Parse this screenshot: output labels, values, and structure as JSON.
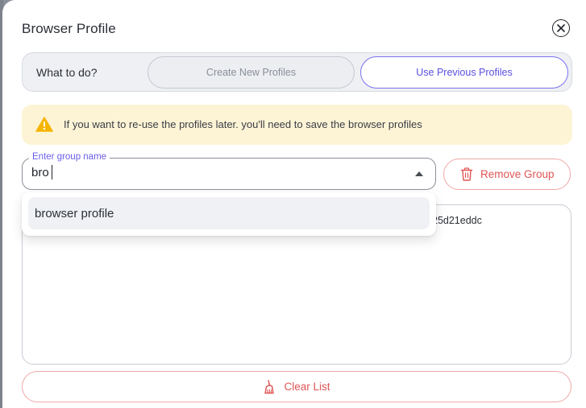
{
  "modal": {
    "title": "Browser Profile"
  },
  "segmented": {
    "label": "What to do?",
    "options": [
      {
        "label": "Create New Profiles",
        "active": false
      },
      {
        "label": "Use Previous Profiles",
        "active": true
      }
    ]
  },
  "alert": {
    "text": "If you want to re-use the profiles later. you'll need to save the browser profiles",
    "icon": "warning-icon"
  },
  "group": {
    "legend": "Enter group name",
    "value": "bro",
    "remove_label": "Remove Group",
    "remove_icon": "trash-icon"
  },
  "dropdown": {
    "options": [
      "browser profile"
    ]
  },
  "list": {
    "visible_text": "25d21eddc"
  },
  "footer": {
    "clear_label": "Clear List",
    "clear_icon": "broom-icon"
  },
  "colors": {
    "accent": "#6a5ee8",
    "danger": "#e05555",
    "warning": "#f5b400",
    "alert_bg": "#fdf4d6"
  }
}
